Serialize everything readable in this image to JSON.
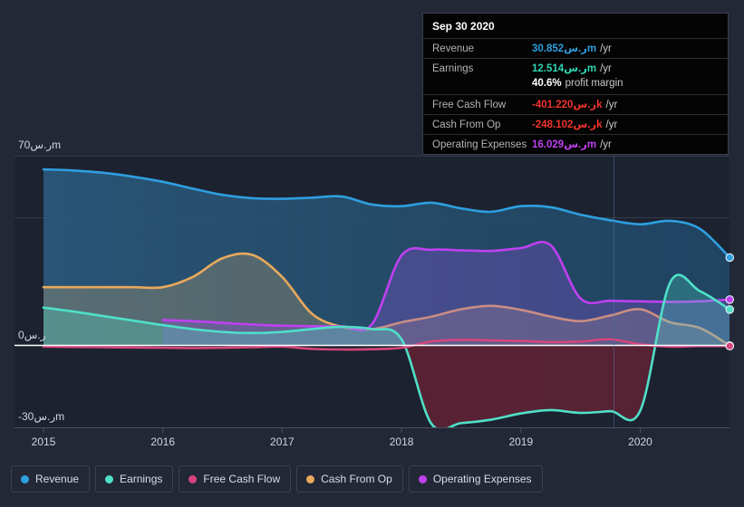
{
  "tooltip": {
    "date": "Sep 30 2020",
    "rows": [
      {
        "label": "Revenue",
        "value": "30.852ر.سm",
        "unit": "/yr"
      },
      {
        "label": "Earnings",
        "value": "12.514ر.سm",
        "unit": "/yr"
      },
      {
        "label": "",
        "value": "40.6%",
        "unit": "profit margin"
      },
      {
        "label": "Free Cash Flow",
        "value": "-401.220ر.سk",
        "unit": "/yr"
      },
      {
        "label": "Cash From Op",
        "value": "-248.102ر.سk",
        "unit": "/yr"
      },
      {
        "label": "Operating Expenses",
        "value": "16.029ر.سm",
        "unit": "/yr"
      }
    ]
  },
  "legend": {
    "items": [
      {
        "label": "Revenue",
        "color": "#2e9fe0"
      },
      {
        "label": "Earnings",
        "color": "#4fe0c8"
      },
      {
        "label": "Free Cash Flow",
        "color": "#d6457d"
      },
      {
        "label": "Cash From Op",
        "color": "#e8a95c"
      },
      {
        "label": "Operating Expenses",
        "color": "#bf40f0"
      }
    ]
  },
  "axis": {
    "y_labels": [
      {
        "text": "70ر.سm"
      },
      {
        "text": "0ر.س"
      },
      {
        "text": "-30ر.سm"
      }
    ],
    "x_labels": [
      "2015",
      "2016",
      "2017",
      "2018",
      "2019",
      "2020"
    ]
  },
  "chart_data": {
    "type": "area",
    "title": "",
    "xlabel": "",
    "ylabel": "",
    "ylim": [
      -30,
      70
    ],
    "grid": true,
    "legend_position": "bottom",
    "x_ticks": [
      "2015",
      "2016",
      "2017",
      "2018",
      "2019",
      "2020"
    ],
    "x": [
      2015.0,
      2015.25,
      2015.5,
      2015.75,
      2016.0,
      2016.25,
      2016.5,
      2016.75,
      2017.0,
      2017.25,
      2017.5,
      2017.75,
      2018.0,
      2018.25,
      2018.5,
      2018.75,
      2019.0,
      2019.25,
      2019.5,
      2019.75,
      2020.0,
      2020.25,
      2020.5,
      2020.75
    ],
    "series": [
      {
        "name": "Revenue",
        "color": "#2e9fe0",
        "values": [
          62.0,
          61.6,
          60.8,
          59.4,
          57.6,
          55.2,
          53.0,
          51.8,
          51.6,
          52.0,
          52.4,
          49.6,
          49.0,
          50.2,
          48.2,
          47.0,
          49.0,
          48.6,
          46.0,
          44.0,
          42.6,
          43.8,
          41.0,
          30.852
        ]
      },
      {
        "name": "Earnings",
        "color": "#4fe0c8",
        "values": [
          13.2,
          11.8,
          10.2,
          8.6,
          7.0,
          5.6,
          4.6,
          4.2,
          4.6,
          5.6,
          6.4,
          5.6,
          2.0,
          -27.8,
          -27.6,
          -26.4,
          -24.2,
          -23.0,
          -24.0,
          -23.4,
          -23.2,
          22.0,
          19.0,
          12.514
        ]
      },
      {
        "name": "Free Cash Flow",
        "color": "#d6457d",
        "values": [
          -0.6,
          -0.7,
          -0.8,
          -0.9,
          -1.0,
          -1.1,
          -1.0,
          -0.8,
          -0.6,
          -1.4,
          -1.6,
          -1.5,
          -1.0,
          1.2,
          1.8,
          1.6,
          1.4,
          1.0,
          1.2,
          2.0,
          0.2,
          -0.6,
          -0.4,
          -0.401
        ]
      },
      {
        "name": "Cash From Op",
        "color": "#e8a95c",
        "values": [
          20.4,
          20.4,
          20.4,
          20.4,
          20.4,
          24.0,
          30.6,
          31.8,
          24.0,
          11.0,
          6.4,
          5.6,
          8.0,
          10.0,
          12.6,
          13.8,
          12.4,
          10.0,
          8.4,
          10.4,
          12.6,
          8.0,
          6.0,
          -0.248
        ]
      },
      {
        "name": "Operating Expenses",
        "color": "#bf40f0",
        "values": [
          null,
          null,
          null,
          null,
          8.8,
          8.4,
          7.8,
          7.2,
          6.8,
          6.6,
          6.6,
          7.2,
          31.6,
          33.6,
          33.4,
          33.2,
          34.2,
          35.2,
          16.4,
          15.6,
          15.4,
          15.2,
          15.4,
          16.029
        ]
      }
    ]
  }
}
